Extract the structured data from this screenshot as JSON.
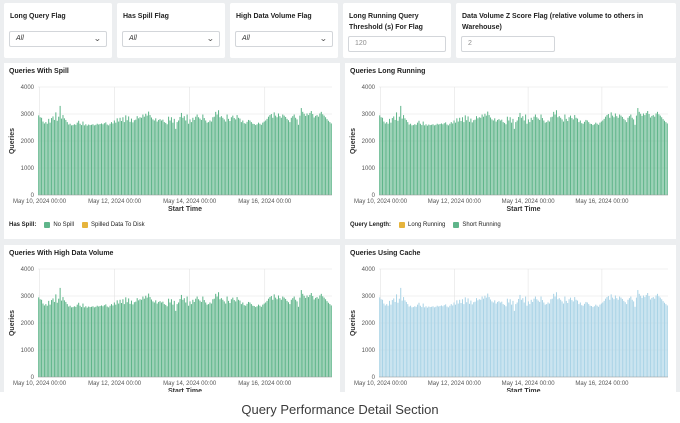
{
  "filters": {
    "long_query_flag": {
      "label": "Long Query Flag",
      "value": "All"
    },
    "has_spill_flag": {
      "label": "Has Spill Flag",
      "value": "All"
    },
    "high_data_volume_flag": {
      "label": "High Data Volume Flag",
      "value": "All"
    },
    "long_running_threshold": {
      "label": "Long Running Query Threshold (s) For Flag",
      "value": "120"
    },
    "data_volume_z_score": {
      "label": "Data Volume Z Score Flag (relative volume to others in Warehouse)",
      "value": "2"
    }
  },
  "panels": {
    "spill": {
      "title": "Queries With Spill",
      "legend_title": "Has Spill:",
      "legend": [
        {
          "label": "No Spill",
          "color": "#5fb58a"
        },
        {
          "label": "Spilled Data To Disk",
          "color": "#e6b43c"
        }
      ]
    },
    "long_running": {
      "title": "Queries Long Running",
      "legend_title": "Query Length:",
      "legend": [
        {
          "label": "Long Running",
          "color": "#e6b43c"
        },
        {
          "label": "Short Running",
          "color": "#5fb58a"
        }
      ]
    },
    "high_volume": {
      "title": "Queries With High Data Volume"
    },
    "cache": {
      "title": "Queries Using Cache"
    }
  },
  "chart_data": [
    {
      "type": "bar",
      "title": "Queries With Spill",
      "xlabel": "Start Time",
      "ylabel": "Queries",
      "ylim": [
        0,
        4000
      ],
      "yticks": [
        "0",
        "1000",
        "2000",
        "3000",
        "4000"
      ],
      "xticks": [
        "May 10, 2024 00:00",
        "May 12, 2024 00:00",
        "May 14, 2024 00:00",
        "May 16, 2024 00:00"
      ],
      "x_range": [
        "May 9, 2024 23:00",
        "May 17, 2024 19:00"
      ],
      "color": "#5fb58a",
      "series": [
        {
          "name": "No Spill",
          "values": [
            2950,
            2880,
            2860,
            2720,
            2650,
            2700,
            2640,
            2820,
            2680,
            2850,
            2910,
            2780,
            3060,
            2750,
            2900,
            3300,
            2830,
            2960,
            2840,
            2780,
            2700,
            2610,
            2640,
            2580,
            2590,
            2620,
            2600,
            2680,
            2750,
            2640,
            2590,
            2720,
            2580,
            2620,
            2570,
            2610,
            2590,
            2600,
            2620,
            2580,
            2600,
            2640,
            2610,
            2630,
            2650,
            2620,
            2660,
            2690,
            2610,
            2580,
            2640,
            2700,
            2650,
            2760,
            2680,
            2840,
            2720,
            2860,
            2740,
            2880,
            2700,
            2950,
            2770,
            2910,
            2710,
            2830,
            2690,
            2770,
            2790,
            2920,
            2840,
            2880,
            2860,
            2980,
            2900,
            3010,
            2940,
            3090,
            2960,
            2870,
            2800,
            2760,
            2840,
            2720,
            2780,
            2810,
            2760,
            2790,
            2700,
            2670,
            2620,
            2900,
            2760,
            2880,
            2680,
            2820,
            2450,
            2700,
            2760,
            2890,
            3040,
            2860,
            2920,
            2760,
            2980,
            2640,
            2800,
            2700,
            2860,
            2780,
            2900,
            2980,
            2880,
            2830,
            2780,
            2980,
            2850,
            2760,
            2680,
            2700,
            2760,
            2720,
            2880,
            2900,
            3080,
            2980,
            3140,
            2880,
            2920,
            2860,
            2800,
            2720,
            2980,
            2820,
            2740,
            2880,
            2940,
            2850,
            2800,
            2960,
            2860,
            2830,
            2700,
            2760,
            2660,
            2640,
            2710,
            2780,
            2760,
            2700,
            2640,
            2630,
            2590,
            2620,
            2680,
            2640,
            2600,
            2680,
            2720,
            2760,
            2820,
            2900,
            2960,
            3000,
            2860,
            3060,
            2940,
            2880,
            3020,
            2920,
            2860,
            2980,
            2940,
            2890,
            2820,
            2770,
            2700,
            2860,
            2920,
            2980,
            2860,
            2800,
            2600,
            2940,
            3220,
            3080,
            3010,
            2930,
            3020,
            2960,
            3040,
            3110,
            3000,
            2870,
            2930,
            2960,
            2900,
            3020,
            3080,
            2990,
            2940,
            2880,
            2810,
            2750,
            2700,
            2650
          ]
        },
        {
          "name": "Spilled Data To Disk",
          "values": []
        }
      ]
    },
    {
      "type": "bar",
      "title": "Queries Long Running",
      "xlabel": "Start Time",
      "ylabel": "Queries",
      "ylim": [
        0,
        4000
      ],
      "yticks": [
        "0",
        "1000",
        "2000",
        "3000",
        "4000"
      ],
      "xticks": [
        "May 10, 2024 00:00",
        "May 12, 2024 00:00",
        "May 14, 2024 00:00",
        "May 16, 2024 00:00"
      ],
      "x_range": [
        "May 9, 2024 23:00",
        "May 17, 2024 19:00"
      ],
      "color": "#5fb58a",
      "series": [
        {
          "name": "Short Running",
          "values": [
            2950,
            2880,
            2860,
            2720,
            2650,
            2700,
            2640,
            2820,
            2680,
            2850,
            2910,
            2780,
            3060,
            2750,
            2900,
            3300,
            2830,
            2960,
            2840,
            2780,
            2700,
            2610,
            2640,
            2580,
            2590,
            2620,
            2600,
            2680,
            2750,
            2640,
            2590,
            2720,
            2580,
            2620,
            2570,
            2610,
            2590,
            2600,
            2620,
            2580,
            2600,
            2640,
            2610,
            2630,
            2650,
            2620,
            2660,
            2690,
            2610,
            2580,
            2640,
            2700,
            2650,
            2760,
            2680,
            2840,
            2720,
            2860,
            2740,
            2880,
            2700,
            2950,
            2770,
            2910,
            2710,
            2830,
            2690,
            2770,
            2790,
            2920,
            2840,
            2880,
            2860,
            2980,
            2900,
            3010,
            2940,
            3090,
            2960,
            2870,
            2800,
            2760,
            2840,
            2720,
            2780,
            2810,
            2760,
            2790,
            2700,
            2670,
            2620,
            2900,
            2760,
            2880,
            2680,
            2820,
            2450,
            2700,
            2760,
            2890,
            3040,
            2860,
            2920,
            2760,
            2980,
            2640,
            2800,
            2700,
            2860,
            2780,
            2900,
            2980,
            2880,
            2830,
            2780,
            2980,
            2850,
            2760,
            2680,
            2700,
            2760,
            2720,
            2880,
            2900,
            3080,
            2980,
            3140,
            2880,
            2920,
            2860,
            2800,
            2720,
            2980,
            2820,
            2740,
            2880,
            2940,
            2850,
            2800,
            2960,
            2860,
            2830,
            2700,
            2760,
            2660,
            2640,
            2710,
            2780,
            2760,
            2700,
            2640,
            2630,
            2590,
            2620,
            2680,
            2640,
            2600,
            2680,
            2720,
            2760,
            2820,
            2900,
            2960,
            3000,
            2860,
            3060,
            2940,
            2880,
            3020,
            2920,
            2860,
            2980,
            2940,
            2890,
            2820,
            2770,
            2700,
            2860,
            2920,
            2980,
            2860,
            2800,
            2600,
            2940,
            3220,
            3080,
            3010,
            2930,
            3020,
            2960,
            3040,
            3110,
            3000,
            2870,
            2930,
            2960,
            2900,
            3020,
            3080,
            2990,
            2940,
            2880,
            2810,
            2750,
            2700,
            2650
          ]
        },
        {
          "name": "Long Running",
          "values": []
        }
      ]
    },
    {
      "type": "bar",
      "title": "Queries With High Data Volume",
      "xlabel": "Start Time",
      "ylabel": "Queries",
      "ylim": [
        0,
        4000
      ],
      "yticks": [
        "0",
        "1000",
        "2000",
        "3000",
        "4000"
      ],
      "xticks": [
        "May 10, 2024 00:00",
        "May 12, 2024 00:00",
        "May 14, 2024 00:00",
        "May 16, 2024 00:00"
      ],
      "x_range": [
        "May 9, 2024 23:00",
        "May 17, 2024 19:00"
      ],
      "color": "#5fb58a",
      "series": [
        {
          "name": "",
          "values": [
            2950,
            2880,
            2860,
            2720,
            2650,
            2700,
            2640,
            2820,
            2680,
            2850,
            2910,
            2780,
            3060,
            2750,
            2900,
            3300,
            2830,
            2960,
            2840,
            2780,
            2700,
            2610,
            2640,
            2580,
            2590,
            2620,
            2600,
            2680,
            2750,
            2640,
            2590,
            2720,
            2580,
            2620,
            2570,
            2610,
            2590,
            2600,
            2620,
            2580,
            2600,
            2640,
            2610,
            2630,
            2650,
            2620,
            2660,
            2690,
            2610,
            2580,
            2640,
            2700,
            2650,
            2760,
            2680,
            2840,
            2720,
            2860,
            2740,
            2880,
            2700,
            2950,
            2770,
            2910,
            2710,
            2830,
            2690,
            2770,
            2790,
            2920,
            2840,
            2880,
            2860,
            2980,
            2900,
            3010,
            2940,
            3090,
            2960,
            2870,
            2800,
            2760,
            2840,
            2720,
            2780,
            2810,
            2760,
            2790,
            2700,
            2670,
            2620,
            2900,
            2760,
            2880,
            2680,
            2820,
            2450,
            2700,
            2760,
            2890,
            3040,
            2860,
            2920,
            2760,
            2980,
            2640,
            2800,
            2700,
            2860,
            2780,
            2900,
            2980,
            2880,
            2830,
            2780,
            2980,
            2850,
            2760,
            2680,
            2700,
            2760,
            2720,
            2880,
            2900,
            3080,
            2980,
            3140,
            2880,
            2920,
            2860,
            2800,
            2720,
            2980,
            2820,
            2740,
            2880,
            2940,
            2850,
            2800,
            2960,
            2860,
            2830,
            2700,
            2760,
            2660,
            2640,
            2710,
            2780,
            2760,
            2700,
            2640,
            2630,
            2590,
            2620,
            2680,
            2640,
            2600,
            2680,
            2720,
            2760,
            2820,
            2900,
            2960,
            3000,
            2860,
            3060,
            2940,
            2880,
            3020,
            2920,
            2860,
            2980,
            2940,
            2890,
            2820,
            2770,
            2700,
            2860,
            2920,
            2980,
            2860,
            2800,
            2600,
            2940,
            3220,
            3080,
            3010,
            2930,
            3020,
            2960,
            3040,
            3110,
            3000,
            2870,
            2930,
            2960,
            2900,
            3020,
            3080,
            2990,
            2940,
            2880,
            2810,
            2750,
            2700,
            2650
          ]
        }
      ]
    },
    {
      "type": "bar",
      "title": "Queries Using Cache",
      "xlabel": "Start Time",
      "ylabel": "Queries",
      "ylim": [
        0,
        4000
      ],
      "yticks": [
        "0",
        "1000",
        "2000",
        "3000",
        "4000"
      ],
      "xticks": [
        "May 10, 2024 00:00",
        "May 12, 2024 00:00",
        "May 14, 2024 00:00",
        "May 16, 2024 00:00"
      ],
      "x_range": [
        "May 9, 2024 23:00",
        "May 17, 2024 19:00"
      ],
      "color": "#a9d3e6",
      "series": [
        {
          "name": "",
          "values": [
            2950,
            2880,
            2860,
            2720,
            2650,
            2700,
            2640,
            2820,
            2680,
            2850,
            2910,
            2780,
            3060,
            2750,
            2900,
            3300,
            2830,
            2960,
            2840,
            2780,
            2700,
            2610,
            2640,
            2580,
            2590,
            2620,
            2600,
            2680,
            2750,
            2640,
            2590,
            2720,
            2580,
            2620,
            2570,
            2610,
            2590,
            2600,
            2620,
            2580,
            2600,
            2640,
            2610,
            2630,
            2650,
            2620,
            2660,
            2690,
            2610,
            2580,
            2640,
            2700,
            2650,
            2760,
            2680,
            2840,
            2720,
            2860,
            2740,
            2880,
            2700,
            2950,
            2770,
            2910,
            2710,
            2830,
            2690,
            2770,
            2790,
            2920,
            2840,
            2880,
            2860,
            2980,
            2900,
            3010,
            2940,
            3090,
            2960,
            2870,
            2800,
            2760,
            2840,
            2720,
            2780,
            2810,
            2760,
            2790,
            2700,
            2670,
            2620,
            2900,
            2760,
            2880,
            2680,
            2820,
            2450,
            2700,
            2760,
            2890,
            3040,
            2860,
            2920,
            2760,
            2980,
            2640,
            2800,
            2700,
            2860,
            2780,
            2900,
            2980,
            2880,
            2830,
            2780,
            2980,
            2850,
            2760,
            2680,
            2700,
            2760,
            2720,
            2880,
            2900,
            3080,
            2980,
            3140,
            2880,
            2920,
            2860,
            2800,
            2720,
            2980,
            2820,
            2740,
            2880,
            2940,
            2850,
            2800,
            2960,
            2860,
            2830,
            2700,
            2760,
            2660,
            2640,
            2710,
            2780,
            2760,
            2700,
            2640,
            2630,
            2590,
            2620,
            2680,
            2640,
            2600,
            2680,
            2720,
            2760,
            2820,
            2900,
            2960,
            3000,
            2860,
            3060,
            2940,
            2880,
            3020,
            2920,
            2860,
            2980,
            2940,
            2890,
            2820,
            2770,
            2700,
            2860,
            2920,
            2980,
            2860,
            2800,
            2600,
            2940,
            3220,
            3080,
            3010,
            2930,
            3020,
            2960,
            3040,
            3110,
            3000,
            2870,
            2930,
            2960,
            2900,
            3020,
            3080,
            2990,
            2940,
            2880,
            2810,
            2750,
            2700,
            2650
          ]
        }
      ]
    }
  ],
  "caption": "Query Performance Detail Section"
}
